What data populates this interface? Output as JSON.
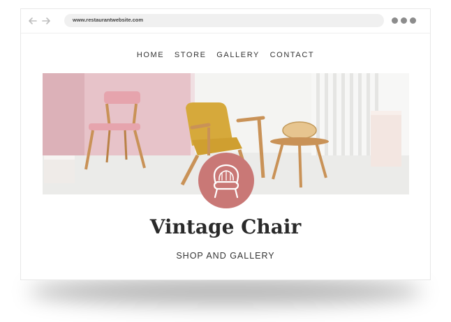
{
  "browser": {
    "url": "www.restaurantwebsite.com",
    "icons": [
      "back-arrow-icon",
      "forward-arrow-icon",
      "more-dots-icon"
    ]
  },
  "nav": {
    "items": [
      "HOME",
      "STORE",
      "GALLERY",
      "CONTACT"
    ]
  },
  "hero": {
    "badge_icon": "armchair-icon"
  },
  "site": {
    "title": "Vintage Chair",
    "subtitle": "SHOP AND GALLERY"
  },
  "colors": {
    "badge": "#c97876",
    "pink_wall": "#e7c3c9",
    "mustard": "#d6a93b",
    "wood": "#c99257"
  }
}
